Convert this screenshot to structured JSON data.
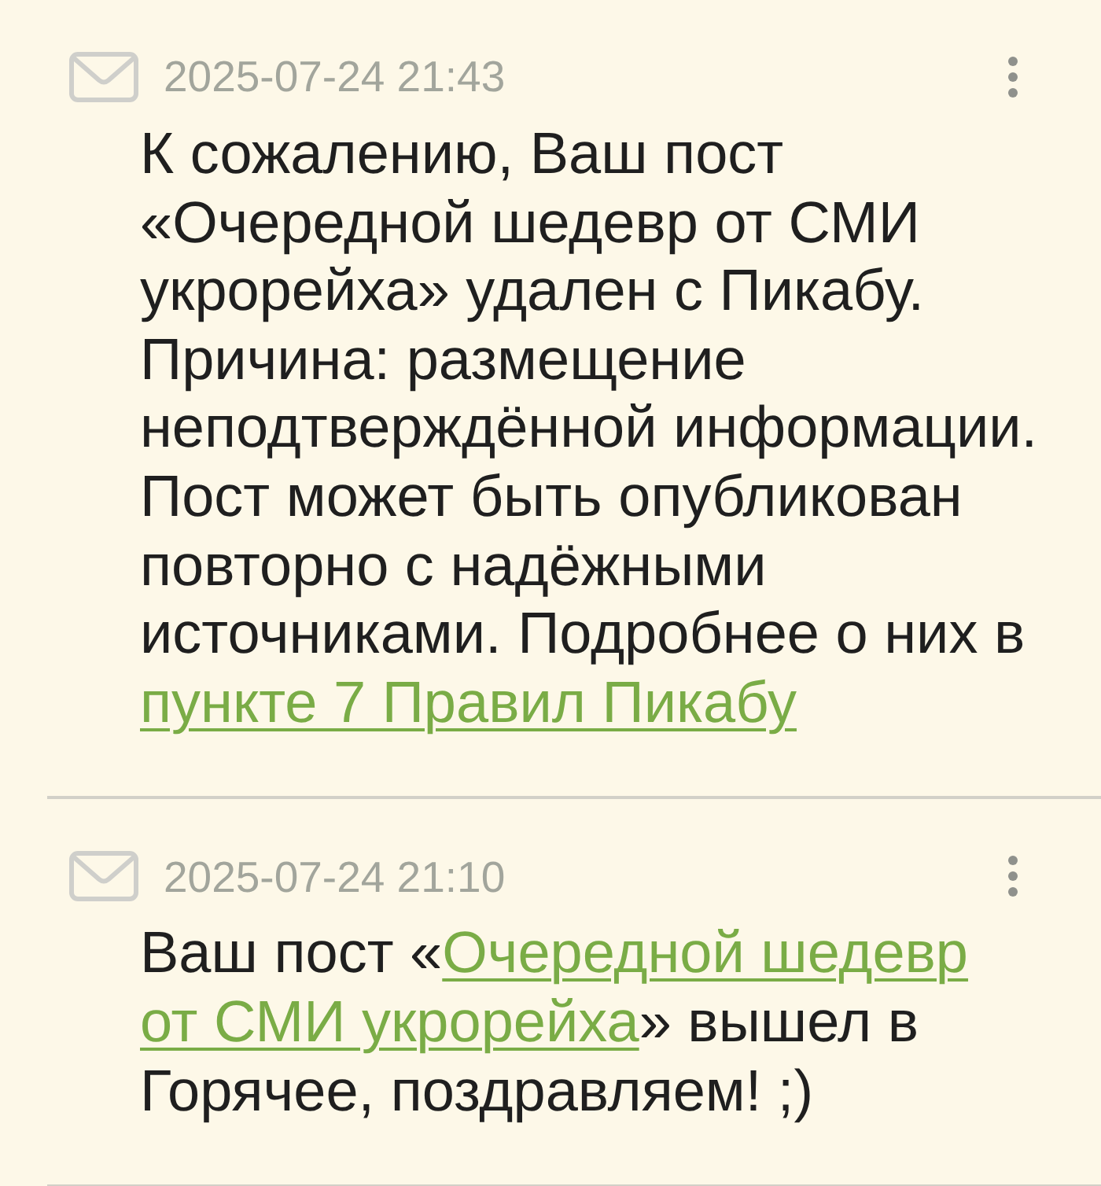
{
  "notifications": [
    {
      "date": "2025-07-24 21:43",
      "message": [
        {
          "kind": "text",
          "text": "К сожалению, Ваш пост «Очередной шедевр от СМИ укрорейха» удален с Пикабу. Причина: размещение неподтверждённой информации. Пост может быть опубликован повторно с надёжными источниками. Подробнее о них в "
        },
        {
          "kind": "link",
          "lines": [
            "пункте 7 Правил Пикабу"
          ]
        }
      ]
    },
    {
      "date": "2025-07-24 21:10",
      "message": [
        {
          "kind": "text",
          "text": "Ваш пост «"
        },
        {
          "kind": "link",
          "lines": [
            "Очередной шедевр",
            "от СМИ укрорейха"
          ]
        },
        {
          "kind": "text",
          "text": "» вышел в Горячее, поздравляем! ;)"
        }
      ]
    }
  ]
}
